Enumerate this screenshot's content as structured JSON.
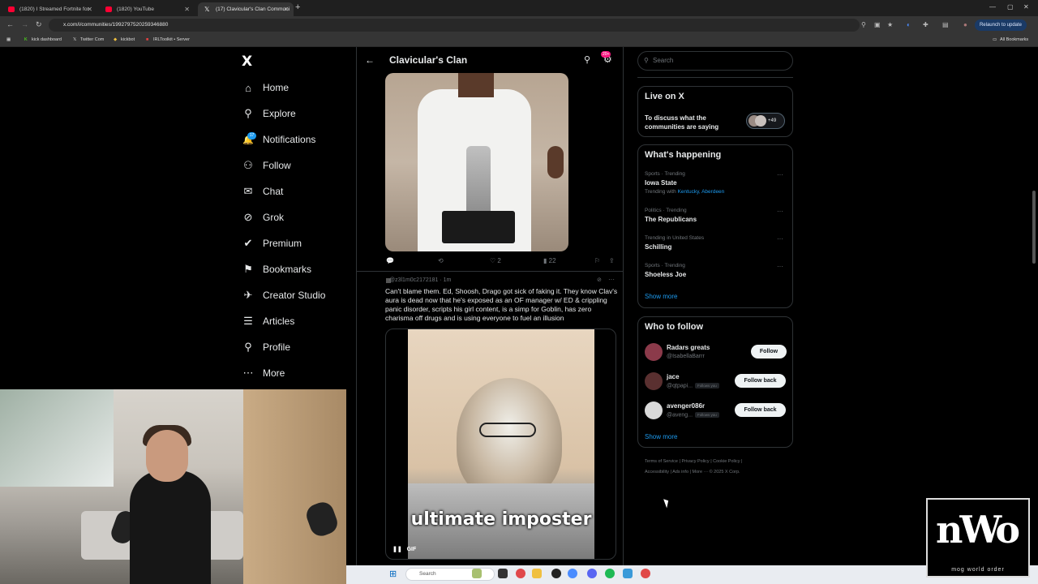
{
  "browser": {
    "tabs": [
      {
        "label": "(1820) I Streamed Fortnite for",
        "favcolor": "#ff0033"
      },
      {
        "label": "(1820) YouTube",
        "favcolor": "#ff0033"
      },
      {
        "label": "(17) Clavicular's Clan Communi",
        "favcolor": "#ffffff"
      }
    ],
    "url": "x.com/i/communities/1992797520259346880",
    "relaunch": "Relaunch to update",
    "bookmarks": [
      "kick dashboard",
      "Twitter Com",
      "kickbot",
      "IRLToolkit • Server"
    ],
    "all_bookmarks": "All Bookmarks"
  },
  "sidebar": {
    "logo": "X",
    "notif_badge": "17",
    "items": [
      {
        "label": "Home",
        "icon": "⌂"
      },
      {
        "label": "Explore",
        "icon": "⚲"
      },
      {
        "label": "Notifications",
        "icon": "🔔"
      },
      {
        "label": "Follow",
        "icon": "⚇"
      },
      {
        "label": "Chat",
        "icon": "✉"
      },
      {
        "label": "Grok",
        "icon": "⊘"
      },
      {
        "label": "Premium",
        "icon": "✔"
      },
      {
        "label": "Bookmarks",
        "icon": "⚑"
      },
      {
        "label": "Creator Studio",
        "icon": "✈"
      },
      {
        "label": "Articles",
        "icon": "☰"
      },
      {
        "label": "Profile",
        "icon": "⚲"
      },
      {
        "label": "More",
        "icon": "⋯"
      }
    ]
  },
  "community": {
    "title": "Clavicular's Clan",
    "badge": "20+"
  },
  "post1": {
    "likes": "2",
    "views": "22"
  },
  "post2": {
    "handle": "@z3l1m0c2172181 · 1m",
    "text": "Can't blame them. Ed, Shoosh, Drago got sick of faking it. They know Clav's aura is dead now that he's exposed as an OF manager w/ ED & crippling panic disorder, scripts his girl content, is a simp for Goblin, has zero charisma off drugs and is using everyone to fuel an illusion",
    "gif_caption": "ultimate imposter",
    "gif_label": "GIF"
  },
  "right": {
    "search_placeholder": "Search",
    "live": {
      "title": "Live on X",
      "text": "To discuss what the communities are saying",
      "count": "+49"
    },
    "happening": {
      "title": "What's happening",
      "trends": [
        {
          "meta": "Sports · Trending",
          "name": "Iowa State",
          "extra_prefix": "Trending with ",
          "extra_links": "Kentucky, Aberdeen"
        },
        {
          "meta": "Politics · Trending",
          "name": "The Republicans",
          "extra_prefix": "",
          "extra_links": ""
        },
        {
          "meta": "Trending in United States",
          "name": "Schilling",
          "extra_prefix": "",
          "extra_links": ""
        },
        {
          "meta": "Sports · Trending",
          "name": "Shoeless Joe",
          "extra_prefix": "",
          "extra_links": ""
        }
      ],
      "show_more": "Show more"
    },
    "who": {
      "title": "Who to follow",
      "users": [
        {
          "name": "Radars greats",
          "handle": "@IsabellaBarrr",
          "button": "Follow",
          "follows_you": "",
          "avatar_color": "#8b3a4a"
        },
        {
          "name": "jace",
          "handle": "@qtpapi...",
          "button": "Follow back",
          "follows_you": "Follows you",
          "avatar_color": "#5a3030"
        },
        {
          "name": "avenger086r",
          "handle": "@aveng...",
          "button": "Follow back",
          "follows_you": "Follows you",
          "avatar_color": "#d8d8d8"
        }
      ],
      "show_more": "Show more"
    },
    "footer": {
      "line1": "Terms of Service  |  Privacy Policy  |  Cookie Policy  |",
      "line2": "Accessibility  |  Ads info  |  More ···  © 2025 X Corp."
    }
  },
  "taskbar": {
    "search": "Search"
  },
  "overlay": {
    "logo_big": "nWo",
    "logo_sub": "mog world order"
  }
}
